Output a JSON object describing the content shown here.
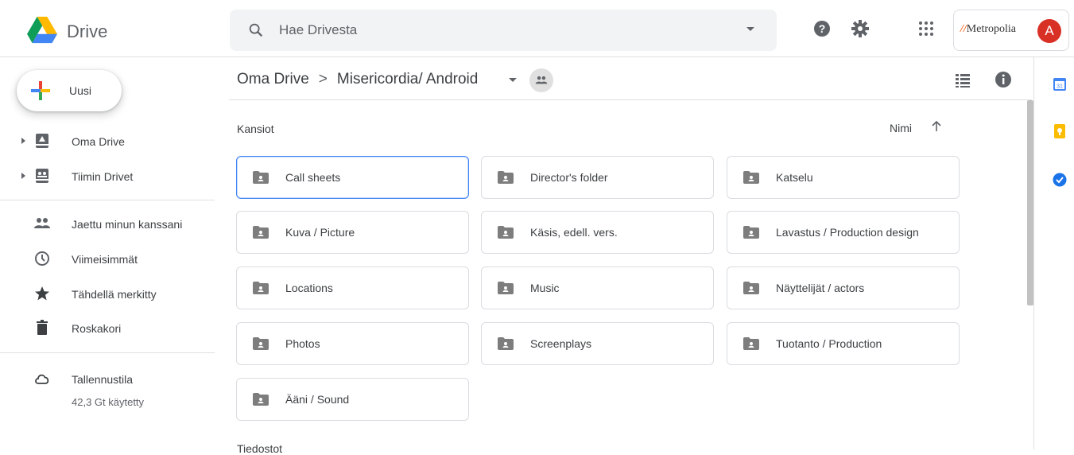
{
  "header": {
    "app_title": "Drive",
    "search_placeholder": "Hae Drivesta",
    "org_name": "Metropolia",
    "avatar_letter": "A"
  },
  "sidebar": {
    "new_label": "Uusi",
    "items": [
      {
        "label": "Oma Drive",
        "icon": "my-drive-icon"
      },
      {
        "label": "Tiimin Drivet",
        "icon": "shared-drives-icon"
      },
      {
        "label": "Jaettu minun kanssani",
        "icon": "shared-with-me-icon"
      },
      {
        "label": "Viimeisimmät",
        "icon": "clock-icon"
      },
      {
        "label": "Tähdellä merkitty",
        "icon": "star-icon"
      },
      {
        "label": "Roskakori",
        "icon": "trash-icon"
      },
      {
        "label": "Tallennustila",
        "icon": "cloud-icon"
      }
    ],
    "storage_used": "42,3 Gt käytetty"
  },
  "breadcrumb": {
    "root": "Oma Drive",
    "separator": ">",
    "current": "Misericordia/ Android"
  },
  "main": {
    "folders_heading": "Kansiot",
    "files_heading": "Tiedostot",
    "sort_label": "Nimi",
    "folders": [
      "Call sheets",
      "Director's folder",
      "Katselu",
      "Kuva / Picture",
      "Käsis, edell. vers.",
      "Lavastus / Production design",
      "Locations",
      "Music",
      "Näyttelijät / actors",
      "Photos",
      "Screenplays",
      "Tuotanto / Production",
      "Ääni / Sound"
    ],
    "selected_folder": "Call sheets"
  },
  "colors": {
    "accent": "#4285f4",
    "icon_gray": "#5f6368",
    "avatar": "#d93025"
  }
}
